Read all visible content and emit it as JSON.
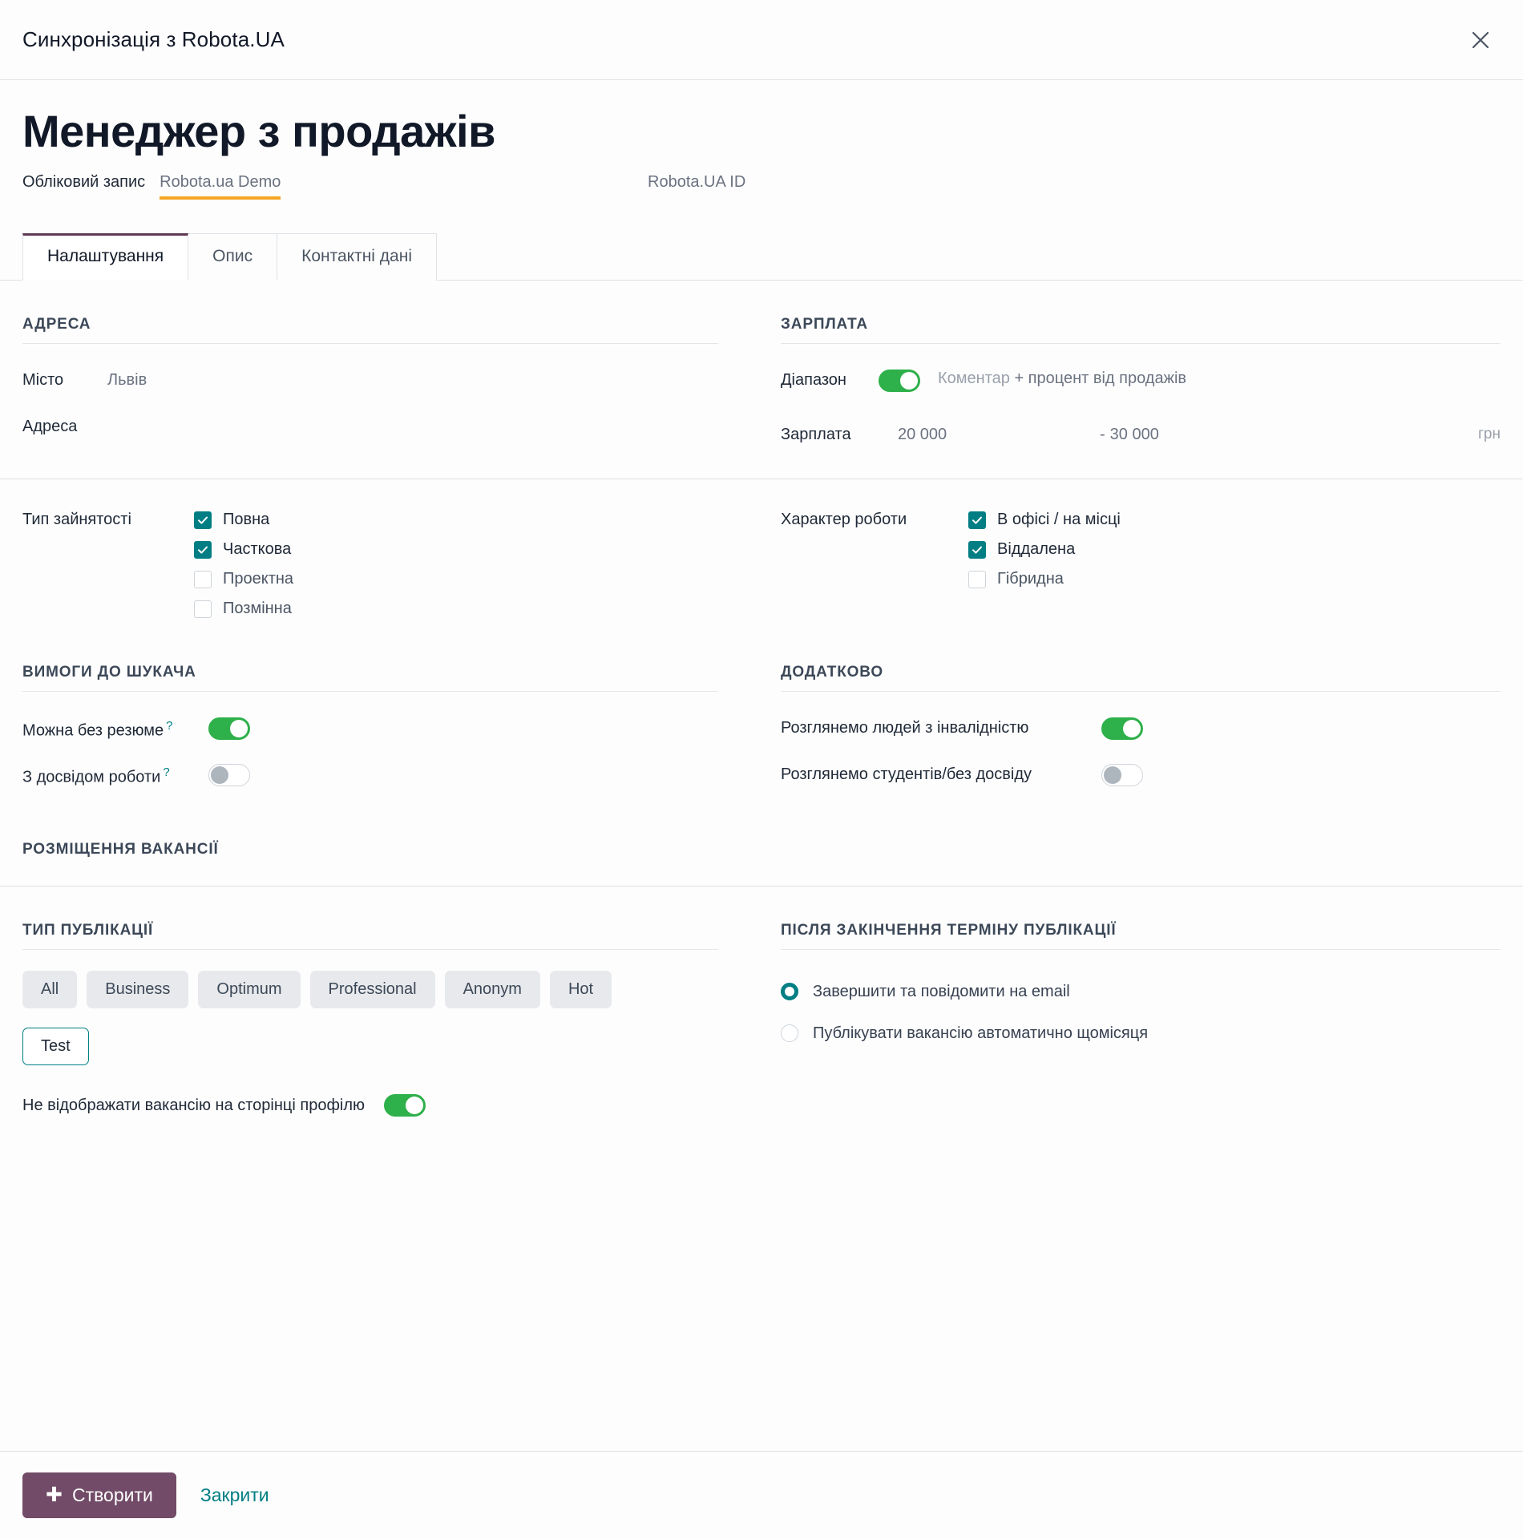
{
  "modal": {
    "title": "Синхронізація з Robota.UA",
    "close_icon": "close-icon"
  },
  "record": {
    "title": "Менеджер з продажів",
    "account_label": "Обліковий запис",
    "account_value": "Robota.ua Demo",
    "robota_id_label": "Robota.UA ID",
    "robota_id_value": ""
  },
  "tabs": [
    {
      "label": "Налаштування",
      "active": true
    },
    {
      "label": "Опис",
      "active": false
    },
    {
      "label": "Контактні дані",
      "active": false
    }
  ],
  "address": {
    "group_title": "АДРЕСА",
    "city_label": "Місто",
    "city_value": "Львів",
    "address_label": "Адреса",
    "address_value": ""
  },
  "salary": {
    "group_title": "ЗАРПЛАТА",
    "range_label": "Діапазон",
    "range_toggle": "on",
    "comment_label": "Коментар",
    "comment_value": "+ процент від продажів",
    "salary_label": "Зарплата",
    "salary_from": "20 000",
    "dash": "-",
    "salary_to": "30 000",
    "currency": "грн"
  },
  "employment": {
    "group_label": "Тип зайнятості",
    "options": [
      {
        "label": "Повна",
        "checked": true
      },
      {
        "label": "Часткова",
        "checked": true
      },
      {
        "label": "Проектна",
        "checked": false
      },
      {
        "label": "Позмінна",
        "checked": false
      }
    ]
  },
  "work_mode": {
    "group_label": "Характер роботи",
    "options": [
      {
        "label": "В офісі / на місці",
        "checked": true
      },
      {
        "label": "Віддалена",
        "checked": true
      },
      {
        "label": "Гібридна",
        "checked": false
      }
    ]
  },
  "requirements": {
    "group_title": "ВИМОГИ ДО ШУКАЧА",
    "items": [
      {
        "label": "Можна без резюме",
        "help": "?",
        "toggle": "on"
      },
      {
        "label": "З досвідом роботи",
        "help": "?",
        "toggle": "off"
      }
    ]
  },
  "additional": {
    "group_title": "ДОДАТКОВО",
    "items": [
      {
        "label": "Розглянемо людей з інвалідністю",
        "toggle": "on"
      },
      {
        "label": "Розглянемо студентів/без досвіду",
        "toggle": "off"
      }
    ]
  },
  "placement": {
    "group_title": "РОЗМІЩЕННЯ ВАКАНСІЇ"
  },
  "publication_type": {
    "group_title": "ТИП ПУБЛІКАЦІЇ",
    "chips": [
      {
        "label": "All",
        "selected": false
      },
      {
        "label": "Business",
        "selected": false
      },
      {
        "label": "Optimum",
        "selected": false
      },
      {
        "label": "Professional",
        "selected": false
      },
      {
        "label": "Anonym",
        "selected": false
      },
      {
        "label": "Hot",
        "selected": false
      },
      {
        "label": "Test",
        "selected": true
      }
    ]
  },
  "after_expiry": {
    "group_title": "ПІСЛЯ ЗАКІНЧЕННЯ ТЕРМІНУ ПУБЛІКАЦІЇ",
    "options": [
      {
        "label": "Завершити та повідомити на email",
        "selected": true
      },
      {
        "label": "Публікувати вакансію автоматично щомісяця",
        "selected": false
      }
    ]
  },
  "hide_on_profile": {
    "label": "Не відображати вакансію на сторінці профілю",
    "toggle": "on"
  },
  "footer": {
    "create_label": "Створити",
    "create_icon": "plus-icon",
    "close_label": "Закрити"
  },
  "colors": {
    "primary": "#714b67",
    "accent_teal": "#017e84",
    "toggle_on_green": "#2eb04a",
    "underline_orange": "#f5a623",
    "tab_active_border": "#5e3a53"
  }
}
